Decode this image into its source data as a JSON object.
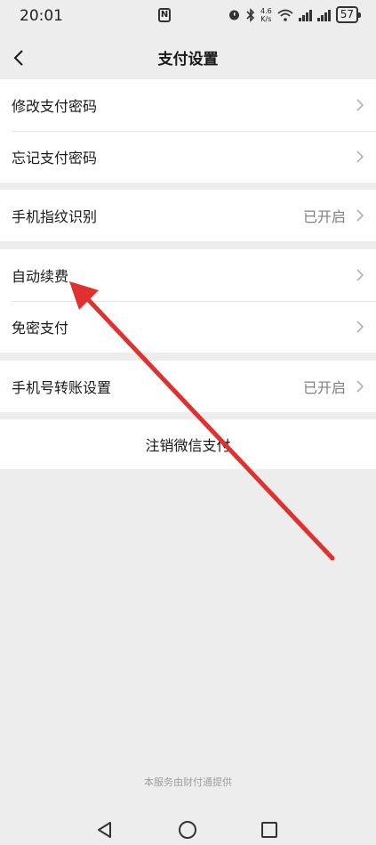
{
  "status_bar": {
    "time": "20:01",
    "nfc": "N",
    "speed_value": "4.6",
    "speed_unit": "K/s",
    "battery": "57"
  },
  "nav": {
    "title": "支付设置"
  },
  "groups": {
    "password": {
      "items": [
        {
          "label": "修改支付密码"
        },
        {
          "label": "忘记支付密码"
        }
      ]
    },
    "fingerprint": {
      "label": "手机指纹识别",
      "value": "已开启"
    },
    "payments": {
      "items": [
        {
          "label": "自动续费"
        },
        {
          "label": "免密支付"
        }
      ]
    },
    "transfer": {
      "label": "手机号转账设置",
      "value": "已开启"
    },
    "cancel": {
      "label": "注销微信支付"
    }
  },
  "footer": {
    "text": "本服务由财付通提供"
  },
  "colors": {
    "background": "#ededed",
    "card": "#ffffff",
    "secondary_text": "#808080",
    "annotation_arrow": "#e03030"
  },
  "icons": {
    "back": "chevron-left-icon",
    "row_indicator": "chevron-right-icon",
    "annotation": "red-arrow-annotation"
  }
}
